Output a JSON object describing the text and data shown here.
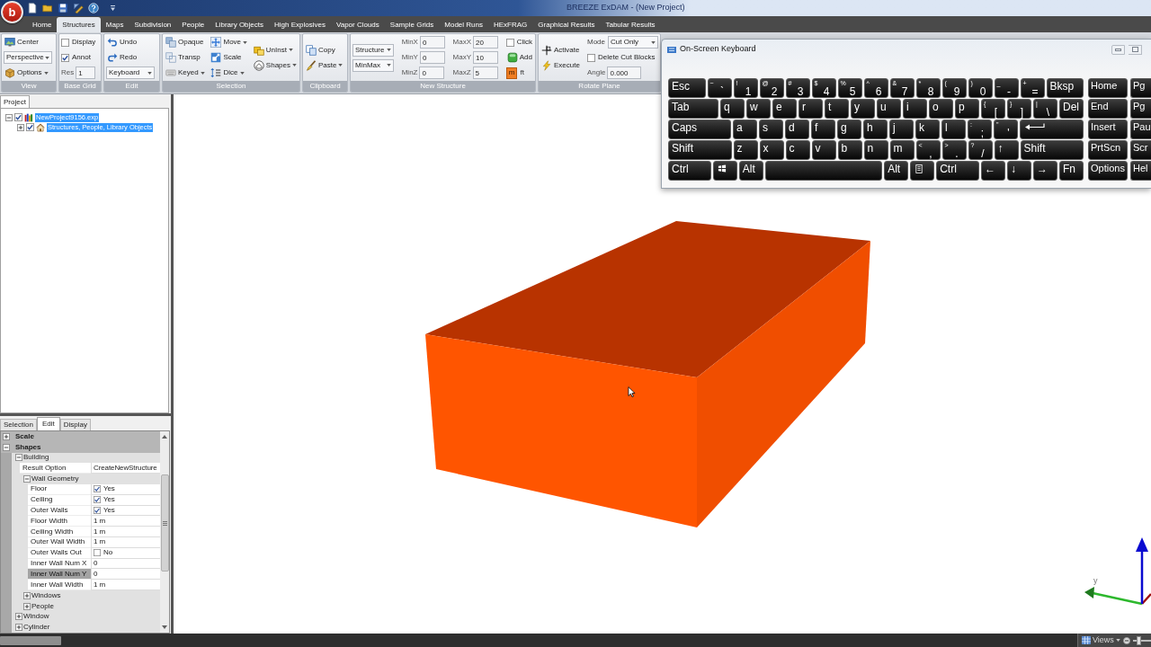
{
  "title_bar": {
    "app_button": "b",
    "title": "BREEZE ExDAM - (New Project)"
  },
  "ribbon": {
    "tabs": [
      {
        "label": "Home",
        "selected": false
      },
      {
        "label": "Structures",
        "selected": true
      },
      {
        "label": "Maps",
        "selected": false
      },
      {
        "label": "Subdivision",
        "selected": false
      },
      {
        "label": "People",
        "selected": false
      },
      {
        "label": "Library Objects",
        "selected": false
      },
      {
        "label": "High Explosives",
        "selected": false
      },
      {
        "label": "Vapor Clouds",
        "selected": false
      },
      {
        "label": "Sample Grids",
        "selected": false
      },
      {
        "label": "Model Runs",
        "selected": false
      },
      {
        "label": "HExFRAG",
        "selected": false
      },
      {
        "label": "Graphical Results",
        "selected": false
      },
      {
        "label": "Tabular Results",
        "selected": false
      }
    ],
    "groups": [
      {
        "label": "View",
        "columns": [
          [
            {
              "kind": "button",
              "label": "Center",
              "has_menu": false
            },
            {
              "kind": "select",
              "value": "Perspective"
            },
            {
              "kind": "button",
              "label": "Options",
              "has_menu": true
            }
          ]
        ]
      },
      {
        "label": "Base Grid",
        "columns": [
          [
            {
              "kind": "checkbox",
              "label": "Display",
              "checked": false
            },
            {
              "kind": "checkbox",
              "label": "Annot",
              "checked": true
            },
            {
              "kind": "field",
              "label": "Res",
              "value": "1"
            }
          ]
        ]
      },
      {
        "label": "Edit",
        "columns": [
          [
            {
              "kind": "button",
              "label": "Undo",
              "has_menu": false
            },
            {
              "kind": "button",
              "label": "Redo",
              "has_menu": false
            },
            {
              "kind": "select",
              "value": "Keyboard"
            }
          ]
        ]
      },
      {
        "label": "Selection",
        "columns": [
          [
            {
              "kind": "button",
              "label": "Opaque",
              "has_menu": false
            },
            {
              "kind": "button",
              "label": "Transp",
              "has_menu": false
            },
            {
              "kind": "button",
              "label": "Keyed",
              "has_menu": true
            }
          ],
          [
            {
              "kind": "button",
              "label": "Move",
              "has_menu": true
            },
            {
              "kind": "button",
              "label": "Scale",
              "has_menu": false
            },
            {
              "kind": "button",
              "label": "Dice",
              "has_menu": true
            }
          ],
          [
            {
              "kind": "button",
              "label": "UnInst",
              "has_menu": true
            },
            {
              "kind": "button",
              "label": "Shapes",
              "has_menu": true
            }
          ]
        ]
      },
      {
        "label": "Clipboard",
        "columns": [
          [
            {
              "kind": "button",
              "label": "Copy",
              "has_menu": false
            },
            {
              "kind": "button",
              "label": "Paste",
              "has_menu": true
            }
          ]
        ]
      },
      {
        "label": "New Structure",
        "columns": [
          [
            {
              "kind": "select",
              "value": "Structure"
            },
            {
              "kind": "select",
              "value": "MinMax"
            }
          ],
          [
            {
              "kind": "field",
              "label": "MinX",
              "value": "0"
            },
            {
              "kind": "field",
              "label": "MinY",
              "value": "0"
            },
            {
              "kind": "field",
              "label": "MinZ",
              "value": "0"
            }
          ],
          [
            {
              "kind": "field",
              "label": "MaxX",
              "value": "20"
            },
            {
              "kind": "field",
              "label": "MaxY",
              "value": "10"
            },
            {
              "kind": "field",
              "label": "MaxZ",
              "value": "5"
            }
          ],
          [
            {
              "kind": "checkbox",
              "label": "Click",
              "checked": false
            },
            {
              "kind": "button",
              "label": "Add",
              "has_menu": false
            },
            {
              "kind": "units",
              "options": [
                {
                  "label": "m",
                  "selected": true
                },
                {
                  "label": "ft",
                  "selected": false
                }
              ]
            }
          ]
        ]
      },
      {
        "label": "Rotate Plane",
        "columns": [
          [
            {
              "kind": "button",
              "label": "Activate",
              "has_menu": false
            },
            {
              "kind": "button",
              "label": "Execute",
              "has_menu": false
            }
          ],
          [
            {
              "kind": "select",
              "label": "Mode",
              "value": "Cut Only"
            },
            {
              "kind": "checkbox",
              "label": "Delete Cut Blocks",
              "checked": false
            },
            {
              "kind": "field",
              "label": "Angle",
              "value": "0.000"
            }
          ]
        ]
      }
    ]
  },
  "project_panel": {
    "tabs": [
      {
        "label": "Project",
        "selected": true
      }
    ],
    "tree": [
      {
        "kind": "project",
        "label": "NewProject9156.exp",
        "checked": true,
        "expanded": true,
        "selected": true,
        "children": [
          {
            "kind": "group",
            "label": "Structures, People, Library Objects",
            "checked": true,
            "expanded": false,
            "selected": true
          }
        ]
      }
    ]
  },
  "properties_panel": {
    "tabs": [
      {
        "label": "Selection",
        "selected": false
      },
      {
        "label": "Edit",
        "selected": true
      },
      {
        "label": "Display",
        "selected": false
      }
    ],
    "rows": [
      {
        "kind": "category",
        "label": "Scale",
        "expanded": false,
        "selected": false
      },
      {
        "kind": "category",
        "label": "Shapes",
        "expanded": true,
        "selected": false,
        "children": [
          {
            "kind": "group",
            "label": "Building",
            "expanded": true,
            "selected": false,
            "children": [
              {
                "kind": "text",
                "label": "Result Option",
                "value": "CreateNewStructure",
                "selected": false
              },
              {
                "kind": "group",
                "label": "Wall Geometry",
                "expanded": true,
                "selected": false,
                "children": [
                  {
                    "kind": "check",
                    "label": "Floor",
                    "checked": true,
                    "value": "Yes",
                    "selected": false
                  },
                  {
                    "kind": "check",
                    "label": "Ceiling",
                    "checked": true,
                    "value": "Yes",
                    "selected": false
                  },
                  {
                    "kind": "check",
                    "label": "Outer Walls",
                    "checked": true,
                    "value": "Yes",
                    "selected": false
                  },
                  {
                    "kind": "text",
                    "label": "Floor Width",
                    "value": "1 m",
                    "selected": false
                  },
                  {
                    "kind": "text",
                    "label": "Ceiling Width",
                    "value": "1 m",
                    "selected": false
                  },
                  {
                    "kind": "text",
                    "label": "Outer Wall Width",
                    "value": "1 m",
                    "selected": false
                  },
                  {
                    "kind": "check",
                    "label": "Outer Walls Out",
                    "checked": false,
                    "value": "No",
                    "selected": false
                  },
                  {
                    "kind": "text",
                    "label": "Inner Wall Num X",
                    "value": "0",
                    "selected": false
                  },
                  {
                    "kind": "text",
                    "label": "Inner Wall Num Y",
                    "value": "0",
                    "selected": true
                  },
                  {
                    "kind": "text",
                    "label": "Inner Wall Width",
                    "value": "1 m",
                    "selected": false
                  }
                ]
              },
              {
                "kind": "group",
                "label": "Windows",
                "expanded": false,
                "selected": false
              },
              {
                "kind": "group",
                "label": "People",
                "expanded": false,
                "selected": false
              }
            ]
          },
          {
            "kind": "group",
            "label": "Window",
            "expanded": false,
            "selected": false
          },
          {
            "kind": "group",
            "label": "Cylinder",
            "expanded": false,
            "selected": false
          }
        ]
      }
    ]
  },
  "viewport": {
    "axis_label": "y"
  },
  "keyboard_window": {
    "title": "On-Screen Keyboard",
    "rows": [
      {
        "keys": [
          {
            "kind": "wide",
            "label": "Esc"
          },
          {
            "kind": "dual",
            "shift": "~",
            "label": "`"
          },
          {
            "kind": "dual",
            "shift": "!",
            "label": "1"
          },
          {
            "kind": "dual",
            "shift": "@",
            "label": "2"
          },
          {
            "kind": "dual",
            "shift": "#",
            "label": "3"
          },
          {
            "kind": "dual",
            "shift": "$",
            "label": "4"
          },
          {
            "kind": "dual",
            "shift": "%",
            "label": "5"
          },
          {
            "kind": "dual",
            "shift": "^",
            "label": "6"
          },
          {
            "kind": "dual",
            "shift": "&",
            "label": "7"
          },
          {
            "kind": "dual",
            "shift": "*",
            "label": "8"
          },
          {
            "kind": "dual",
            "shift": "(",
            "label": "9"
          },
          {
            "kind": "dual",
            "shift": ")",
            "label": "0"
          },
          {
            "kind": "dual",
            "shift": "_",
            "label": "-"
          },
          {
            "kind": "dual",
            "shift": "+",
            "label": "="
          },
          {
            "kind": "wide",
            "label": "Bksp"
          }
        ],
        "nav": [
          "Home",
          "Pg"
        ]
      },
      {
        "keys": [
          {
            "kind": "wide",
            "label": "Tab"
          },
          {
            "kind": "char",
            "label": "q"
          },
          {
            "kind": "char",
            "label": "w"
          },
          {
            "kind": "char",
            "label": "e"
          },
          {
            "kind": "char",
            "label": "r"
          },
          {
            "kind": "char",
            "label": "t"
          },
          {
            "kind": "char",
            "label": "y"
          },
          {
            "kind": "char",
            "label": "u"
          },
          {
            "kind": "char",
            "label": "i"
          },
          {
            "kind": "char",
            "label": "o"
          },
          {
            "kind": "char",
            "label": "p"
          },
          {
            "kind": "dual",
            "shift": "{",
            "label": "["
          },
          {
            "kind": "dual",
            "shift": "}",
            "label": "]"
          },
          {
            "kind": "dual",
            "shift": "|",
            "label": "\\"
          },
          {
            "kind": "char",
            "label": "Del"
          }
        ],
        "nav": [
          "End",
          "Pg"
        ]
      },
      {
        "keys": [
          {
            "kind": "wide",
            "label": "Caps"
          },
          {
            "kind": "char",
            "label": "a"
          },
          {
            "kind": "char",
            "label": "s"
          },
          {
            "kind": "char",
            "label": "d"
          },
          {
            "kind": "char",
            "label": "f"
          },
          {
            "kind": "char",
            "label": "g"
          },
          {
            "kind": "char",
            "label": "h"
          },
          {
            "kind": "char",
            "label": "j"
          },
          {
            "kind": "char",
            "label": "k"
          },
          {
            "kind": "char",
            "label": "l"
          },
          {
            "kind": "dual",
            "shift": ":",
            "label": ";"
          },
          {
            "kind": "dual",
            "shift": "\"",
            "label": "'"
          },
          {
            "kind": "enter"
          }
        ],
        "nav": [
          "Insert",
          "Pau"
        ]
      },
      {
        "keys": [
          {
            "kind": "wide",
            "label": "Shift"
          },
          {
            "kind": "char",
            "label": "z"
          },
          {
            "kind": "char",
            "label": "x"
          },
          {
            "kind": "char",
            "label": "c"
          },
          {
            "kind": "char",
            "label": "v"
          },
          {
            "kind": "char",
            "label": "b"
          },
          {
            "kind": "char",
            "label": "n"
          },
          {
            "kind": "char",
            "label": "m"
          },
          {
            "kind": "dual",
            "shift": "<",
            "label": ","
          },
          {
            "kind": "dual",
            "shift": ">",
            "label": "."
          },
          {
            "kind": "dual",
            "shift": "?",
            "label": "/"
          },
          {
            "kind": "char",
            "label": "↑"
          },
          {
            "kind": "wide",
            "label": "Shift"
          }
        ],
        "nav": [
          "PrtScn",
          "Scr"
        ]
      },
      {
        "keys": [
          {
            "kind": "wide",
            "label": "Ctrl"
          },
          {
            "kind": "windows"
          },
          {
            "kind": "char",
            "label": "Alt"
          },
          {
            "kind": "space"
          },
          {
            "kind": "char",
            "label": "Alt"
          },
          {
            "kind": "menu"
          },
          {
            "kind": "wide",
            "label": "Ctrl"
          },
          {
            "kind": "char",
            "label": "←"
          },
          {
            "kind": "char",
            "label": "↓"
          },
          {
            "kind": "char",
            "label": "→"
          },
          {
            "kind": "char",
            "label": "Fn"
          }
        ],
        "nav": [
          "Options",
          "Hel"
        ]
      }
    ]
  },
  "status_bar": {
    "views_button": "Views",
    "zoom_slider": {
      "level": 0.3
    }
  }
}
